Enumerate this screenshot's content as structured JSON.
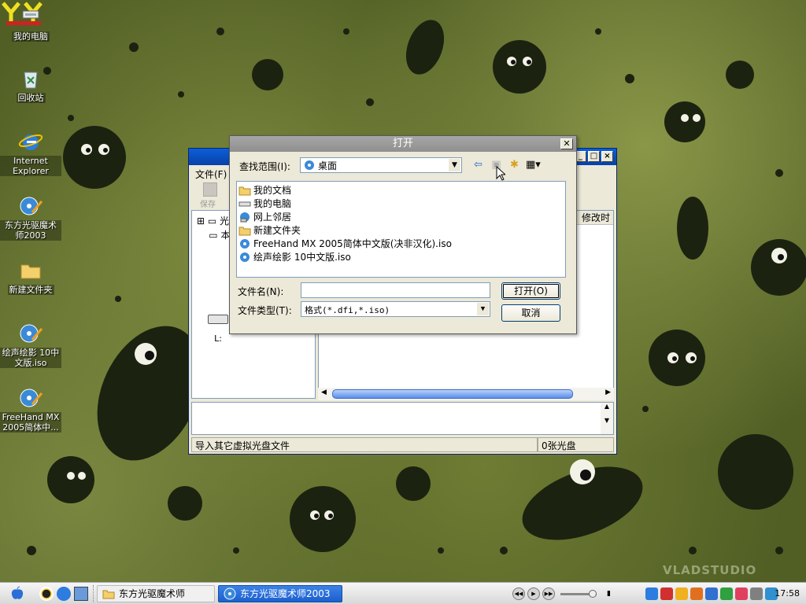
{
  "desktop": {
    "icons": [
      {
        "label": "我的电脑"
      },
      {
        "label": "回收站"
      },
      {
        "label": "Internet Explorer"
      },
      {
        "label": "东方光驱魔术师2003"
      },
      {
        "label": "新建文件夹"
      },
      {
        "label": "绘声绘影 10中文版.iso"
      },
      {
        "label": "FreeHand MX 2005简体中..."
      }
    ],
    "watermark": "VLADSTUDIO"
  },
  "background_window": {
    "menu_file": "文件(F)",
    "toolbar_save": "保存",
    "tree_items": [
      "光",
      "本"
    ],
    "drive_label": "L:",
    "column_modified": "修改时",
    "status_left": "导入其它虚拟光盘文件",
    "status_right": "0张光盘"
  },
  "dialog": {
    "title": "打开",
    "lookin_label": "查找范围(I):",
    "lookin_value": "桌面",
    "items": [
      {
        "name": "我的文档",
        "icon": "my-documents-icon"
      },
      {
        "name": "我的电脑",
        "icon": "my-computer-icon"
      },
      {
        "name": "网上邻居",
        "icon": "network-places-icon"
      },
      {
        "name": "新建文件夹",
        "icon": "folder-icon"
      },
      {
        "name": "FreeHand MX 2005简体中文版(决非汉化).iso",
        "icon": "iso-disc-icon"
      },
      {
        "name": "绘声绘影 10中文版.iso",
        "icon": "iso-disc-icon"
      }
    ],
    "filename_label": "文件名(N):",
    "filename_value": "",
    "filetype_label": "文件类型(T):",
    "filetype_value": "格式(*.dfi,*.iso)",
    "open_button": "打开(O)",
    "cancel_button": "取消"
  },
  "taskbar": {
    "tasks": [
      {
        "label": "东方光驱魔术师",
        "active": false
      },
      {
        "label": "东方光驱魔术师2003",
        "active": true
      }
    ],
    "clock": "17:58"
  },
  "colors": {
    "wallpaper": "#515f25",
    "titlebar_active": "#0a5fd8",
    "titlebar_inactive": "#8f8f8f",
    "task_active": "#1d5fcf"
  }
}
